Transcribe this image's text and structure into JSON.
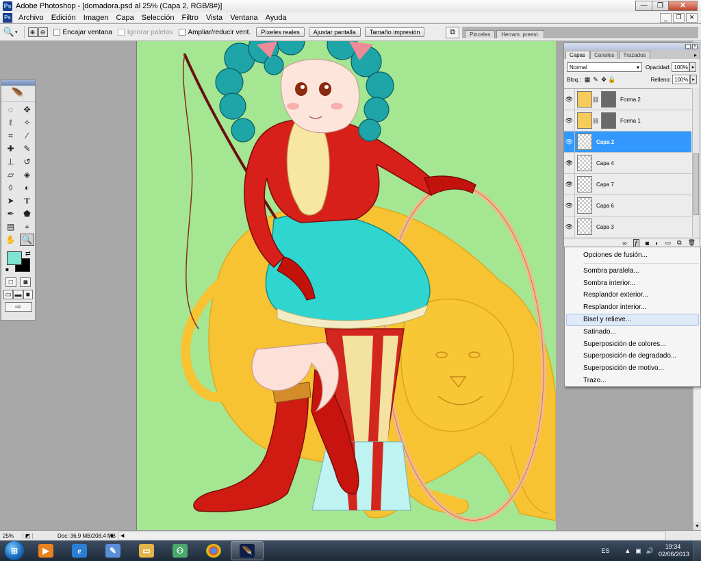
{
  "window": {
    "title": "Adobe Photoshop - [domadora.psd al 25% (Capa 2, RGB/8#)]",
    "app_icon": "Ps",
    "controls": [
      "minimize",
      "restore",
      "close"
    ],
    "minimize_label": "—",
    "restore_label": "❐",
    "close_label": "✕"
  },
  "menu": {
    "items": [
      "Archivo",
      "Edición",
      "Imagen",
      "Capa",
      "Selección",
      "Filtro",
      "Vista",
      "Ventana",
      "Ayuda"
    ],
    "doc_minimize": "_",
    "doc_restore": "❐",
    "doc_close": "✕"
  },
  "options": {
    "tool_icon": "zoom-icon",
    "checkboxes": {
      "fit_window": "Encajar ventana",
      "ignore_palettes": "Ignorar paletas",
      "resize_windows": "Ampliar/reducir vent."
    },
    "buttons": {
      "actual_pixels": "Píxeles reales",
      "fit_screen": "Ajustar pantalla",
      "print_size": "Tamaño impresión"
    },
    "palette_well_tabs": [
      "Pinceles",
      "Herram. preest."
    ]
  },
  "toolbox": {
    "tools": [
      "marquee-tool",
      "move-tool",
      "lasso-tool",
      "magic-wand-tool",
      "crop-tool",
      "slice-tool",
      "healing-brush-tool",
      "brush-tool",
      "clone-stamp-tool",
      "history-brush-tool",
      "eraser-tool",
      "paint-bucket-tool",
      "blur-tool",
      "dodge-tool",
      "path-selection-tool",
      "type-tool",
      "pen-tool",
      "shape-tool",
      "notes-tool",
      "eyedropper-tool",
      "hand-tool",
      "zoom-tool"
    ],
    "active_tool": "zoom-tool",
    "foreground_color": "#7fe3d0",
    "background_color": "#000000"
  },
  "layers_panel": {
    "tabs": [
      "Capas",
      "Canales",
      "Trazados"
    ],
    "active_tab": "Capas",
    "blend_mode": "Normal",
    "opacity_label": "Opacidad:",
    "opacity_value": "100%",
    "lock_label": "Bloq.:",
    "fill_label": "Relleno:",
    "fill_value": "100%",
    "layers": [
      {
        "name": "Forma 2",
        "type": "shape",
        "visible": true,
        "selected": false
      },
      {
        "name": "Forma 1",
        "type": "shape",
        "visible": true,
        "selected": false
      },
      {
        "name": "Capa 2",
        "type": "pixel",
        "visible": true,
        "selected": true
      },
      {
        "name": "Capa 4",
        "type": "pixel",
        "visible": true,
        "selected": false
      },
      {
        "name": "Capa 7",
        "type": "pixel",
        "visible": true,
        "selected": false
      },
      {
        "name": "Capa 6",
        "type": "pixel",
        "visible": true,
        "selected": false
      },
      {
        "name": "Capa 3",
        "type": "pixel",
        "visible": true,
        "selected": false
      }
    ],
    "bottom_icons": [
      "link-layers-icon",
      "layer-style-icon",
      "add-mask-icon",
      "adjustment-layer-icon",
      "new-group-icon",
      "new-layer-icon",
      "delete-layer-icon"
    ]
  },
  "style_menu": {
    "items": [
      "Opciones de fusión...",
      "Sombra paralela...",
      "Sombra interior...",
      "Resplandor exterior...",
      "Resplandor interior...",
      "Bisel y relieve...",
      "Satinado...",
      "Superposición de colores...",
      "Superposición de degradado...",
      "Superposición de motivo...",
      "Trazo..."
    ],
    "highlighted": "Bisel y relieve..."
  },
  "status": {
    "zoom": "25%",
    "doc_info": "Doc: 36,9 MB/208,4 MB"
  },
  "taskbar": {
    "apps": [
      "media-player-icon",
      "internet-explorer-icon",
      "paint-icon",
      "file-explorer-icon",
      "network-icon",
      "chrome-icon",
      "photoshop-icon"
    ],
    "active_app": "photoshop-icon",
    "language": "ES",
    "time": "19:34",
    "date": "02/06/2013"
  },
  "colors": {
    "canvas_background": "#a4e692",
    "selection_blue": "#3399ff",
    "menu_highlight": "#dfe9f7"
  }
}
